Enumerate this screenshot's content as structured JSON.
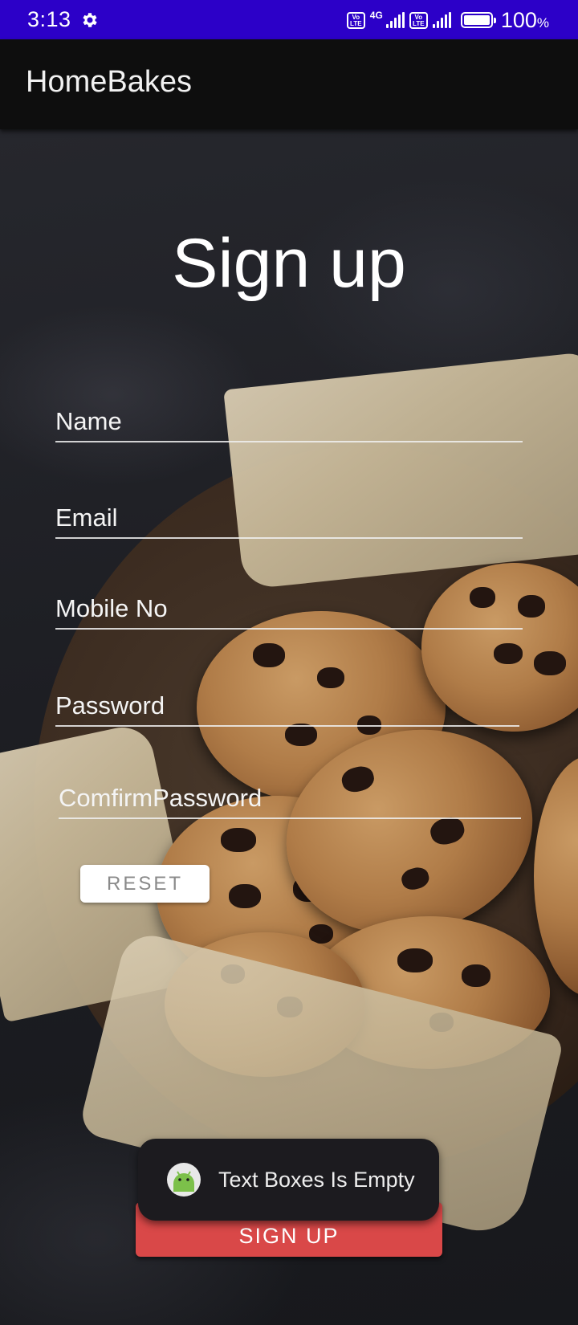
{
  "status_bar": {
    "time": "3:13",
    "network_badge_1": "Vo LTE",
    "network_type": "4G",
    "network_badge_2": "Vo LTE",
    "battery_percent": "100",
    "battery_unit": "%",
    "icons": [
      "gear-icon",
      "volte-icon",
      "signal-icon",
      "battery-icon"
    ]
  },
  "app_bar": {
    "title": "HomeBakes"
  },
  "form": {
    "heading": "Sign up",
    "fields": {
      "name": {
        "placeholder": "Name",
        "value": ""
      },
      "email": {
        "placeholder": "Email",
        "value": ""
      },
      "mobile": {
        "placeholder": "Mobile No",
        "value": ""
      },
      "password": {
        "placeholder": "Password",
        "value": ""
      },
      "confirm_password": {
        "placeholder": "ComfirmPassword",
        "value": ""
      }
    },
    "reset_label": "RESET",
    "signup_label": "SIGN UP"
  },
  "toast": {
    "message": "Text Boxes Is Empty",
    "icon": "android-icon"
  },
  "colors": {
    "status_bar": "#2c00c8",
    "app_bar": "#0e0e0e",
    "signup_button": "#d94848",
    "reset_button": "#ffffff",
    "toast_background": "#1c1b1f"
  }
}
